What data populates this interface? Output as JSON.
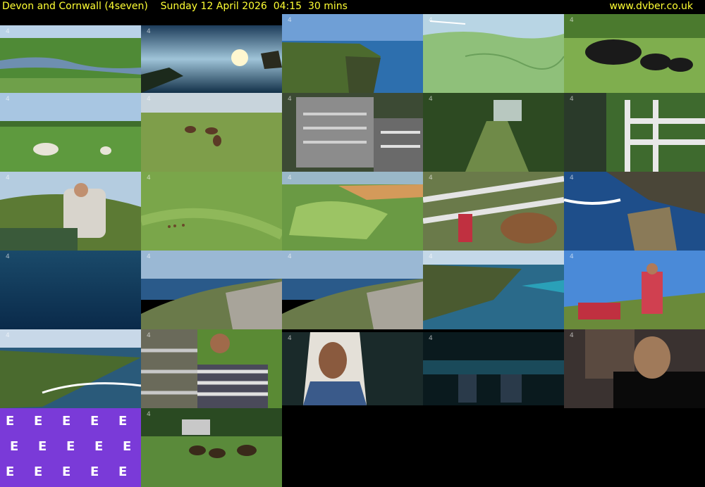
{
  "header": {
    "title": "Devon and Cornwall (4seven)    Sunday 12 April 2026  04:15  30 mins",
    "site": "www.dvber.co.uk"
  },
  "thumbnails": [
    {
      "scene": "river valley with green fields"
    },
    {
      "scene": "sunset over rocky sea coast"
    },
    {
      "scene": "coastal cliffs and blue sea from above"
    },
    {
      "scene": "map of south west coastline"
    },
    {
      "scene": "black cattle in a field"
    },
    {
      "scene": "sheep grazing in a meadow"
    },
    {
      "scene": "horses in tall grass field"
    },
    {
      "scene": "livestock trailer in yard"
    },
    {
      "scene": "wooded country lane"
    },
    {
      "scene": "man opening white metal gate"
    },
    {
      "scene": "man in vehicle on hillside"
    },
    {
      "scene": "aerial view of green field with animals"
    },
    {
      "scene": "aerial view of patchwork farmland"
    },
    {
      "scene": "cattle behind white metal gate"
    },
    {
      "scene": "waves breaking on rocks"
    },
    {
      "scene": "deep blue ocean water"
    },
    {
      "scene": "rocky headland by the sea"
    },
    {
      "scene": "rocky headland by the sea"
    },
    {
      "scene": "cliffs and turquoise sea"
    },
    {
      "scene": "people working on grassy slope"
    },
    {
      "scene": "coastal cliffs with waves"
    },
    {
      "scene": "woman by livestock trailer"
    },
    {
      "scene": "young woman in head covering"
    },
    {
      "scene": "two women in dark bar"
    },
    {
      "scene": "man in black polo shirt interview"
    },
    {
      "scene": "channel logo pattern"
    },
    {
      "scene": "horses running in a paddock"
    }
  ]
}
